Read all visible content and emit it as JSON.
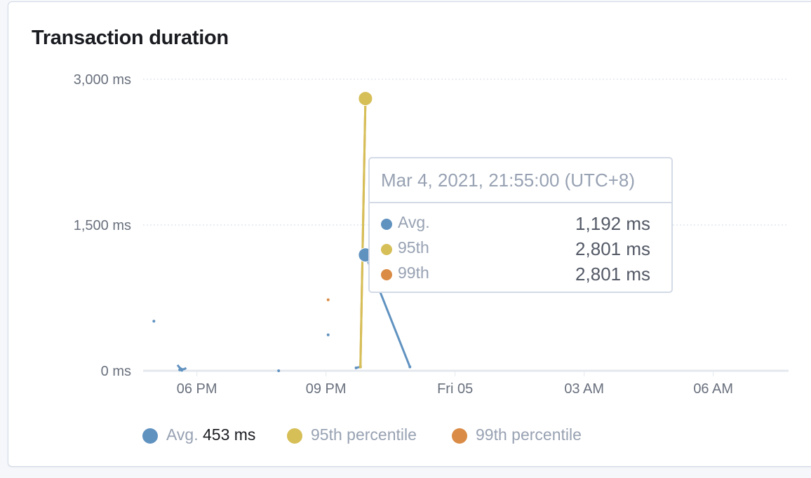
{
  "panel": {
    "title": "Transaction duration"
  },
  "colors": {
    "avg": "#6092c0",
    "p95": "#d6bf57",
    "p99": "#da8b45",
    "grid": "#d3dae6",
    "axis": "#e4e8ee"
  },
  "tooltip": {
    "header": "Mar 4, 2021, 21:55:00 (UTC+8)",
    "rows": [
      {
        "label": "Avg.",
        "value": "1,192 ms",
        "color": "#6092c0"
      },
      {
        "label": "95th",
        "value": "2,801 ms",
        "color": "#d6bf57"
      },
      {
        "label": "99th",
        "value": "2,801 ms",
        "color": "#da8b45"
      }
    ]
  },
  "legend": {
    "avg_label": "Avg.",
    "avg_value": "453 ms",
    "p95_label": "95th percentile",
    "p99_label": "99th percentile"
  },
  "chart_data": {
    "type": "line",
    "x_ticks": [
      "06 PM",
      "09 PM",
      "Fri 05",
      "03 AM",
      "06 AM"
    ],
    "y_ticks": [
      "0 ms",
      "1,500 ms",
      "3,000 ms"
    ],
    "ylim": [
      0,
      3000
    ],
    "xlim_hours": [
      16.75,
      31.75
    ],
    "x_tick_hours": [
      18,
      21,
      24,
      27,
      30
    ],
    "series": [
      {
        "name": "Avg.",
        "color": "#6092c0",
        "points": [
          [
            17.0,
            510
          ],
          [
            17.6,
            10
          ],
          [
            17.65,
            5
          ],
          [
            19.9,
            0
          ],
          [
            21.05,
            370
          ],
          [
            21.7,
            30
          ],
          [
            21.8,
            40
          ],
          [
            21.917,
            1192
          ],
          [
            22.95,
            40
          ]
        ]
      },
      {
        "name": "95th percentile",
        "color": "#d6bf57",
        "points": [
          [
            21.8,
            40
          ],
          [
            21.917,
            2801
          ]
        ]
      },
      {
        "name": "99th percentile",
        "color": "#da8b45",
        "points": [
          [
            21.05,
            730
          ],
          [
            21.8,
            40
          ],
          [
            21.917,
            2801
          ]
        ]
      }
    ],
    "hover_x_hour": 21.917,
    "grid": true,
    "legend_position": "bottom"
  }
}
